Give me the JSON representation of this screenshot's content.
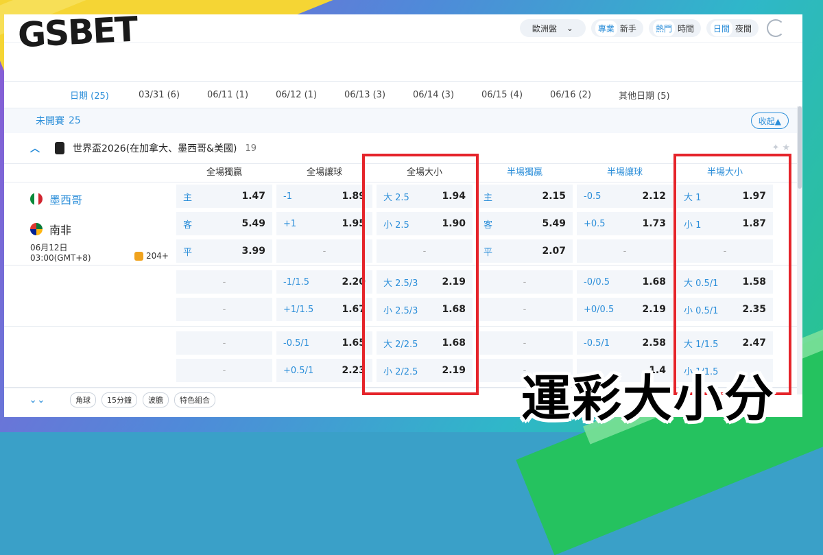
{
  "brand": {
    "logo": "GSBET"
  },
  "headline": "運彩大小分",
  "topbar": {
    "odds_format": "歐洲盤",
    "mode": [
      "專業",
      "新手"
    ],
    "sort": [
      "熱門",
      "時間"
    ],
    "theme": [
      "日間",
      "夜間"
    ]
  },
  "date_tabs": [
    "日期 (25)",
    "03/31 (6)",
    "06/11 (1)",
    "06/12 (1)",
    "06/13 (3)",
    "06/14 (3)",
    "06/15 (4)",
    "06/16 (2)",
    "其他日期 (5)"
  ],
  "section": {
    "title": "未開賽",
    "count": "25",
    "collapse": "收起▲"
  },
  "league": {
    "name": "世界盃2026(在加拿大、墨西哥&美國)",
    "count": "19"
  },
  "columns": [
    "全場獨贏",
    "全場讓球",
    "全場大小",
    "半場獨贏",
    "半場讓球",
    "半場大小"
  ],
  "match": {
    "home": "墨西哥",
    "away": "南非",
    "date": "06月12日",
    "time": "03:00(GMT+8)",
    "more": "204+",
    "rows": [
      [
        {
          "l": "主",
          "v": "1.47"
        },
        {
          "l": "-1",
          "v": "1.89"
        },
        {
          "l": "大 2.5",
          "v": "1.94"
        },
        {
          "l": "主",
          "v": "2.15"
        },
        {
          "l": "-0.5",
          "v": "2.12"
        },
        {
          "l": "大 1",
          "v": "1.97"
        }
      ],
      [
        {
          "l": "客",
          "v": "5.49"
        },
        {
          "l": "+1",
          "v": "1.95"
        },
        {
          "l": "小 2.5",
          "v": "1.90"
        },
        {
          "l": "客",
          "v": "5.49"
        },
        {
          "l": "+0.5",
          "v": "1.73"
        },
        {
          "l": "小 1",
          "v": "1.87"
        }
      ],
      [
        {
          "l": "平",
          "v": "3.99"
        },
        {
          "l": "-",
          "v": ""
        },
        {
          "l": "-",
          "v": ""
        },
        {
          "l": "平",
          "v": "2.07"
        },
        {
          "l": "-",
          "v": ""
        },
        {
          "l": "-",
          "v": ""
        }
      ]
    ]
  },
  "alt_blocks": [
    [
      [
        {
          "l": "-",
          "v": ""
        },
        {
          "l": "-1/1.5",
          "v": "2.20"
        },
        {
          "l": "大 2.5/3",
          "v": "2.19"
        },
        {
          "l": "-",
          "v": ""
        },
        {
          "l": "-0/0.5",
          "v": "1.68"
        },
        {
          "l": "大 0.5/1",
          "v": "1.58"
        }
      ],
      [
        {
          "l": "-",
          "v": ""
        },
        {
          "l": "+1/1.5",
          "v": "1.67"
        },
        {
          "l": "小 2.5/3",
          "v": "1.68"
        },
        {
          "l": "-",
          "v": ""
        },
        {
          "l": "+0/0.5",
          "v": "2.19"
        },
        {
          "l": "小 0.5/1",
          "v": "2.35"
        }
      ]
    ],
    [
      [
        {
          "l": "-",
          "v": ""
        },
        {
          "l": "-0.5/1",
          "v": "1.65"
        },
        {
          "l": "大 2/2.5",
          "v": "1.68"
        },
        {
          "l": "-",
          "v": ""
        },
        {
          "l": "-0.5/1",
          "v": "2.58"
        },
        {
          "l": "大 1/1.5",
          "v": "2.47"
        }
      ],
      [
        {
          "l": "-",
          "v": ""
        },
        {
          "l": "+0.5/1",
          "v": "2.23"
        },
        {
          "l": "小 2/2.5",
          "v": "2.19"
        },
        {
          "l": "-",
          "v": ""
        },
        {
          "l": "",
          "v": "1.4"
        },
        {
          "l": "小 1/1.5",
          "v": ""
        }
      ]
    ]
  ],
  "bottom_chips": [
    "角球",
    "15分鐘",
    "波膽",
    "特色組合"
  ],
  "colors": {
    "accent": "#2b8ed9",
    "highlight": "#e5242a",
    "yellow": "#f5d534",
    "green": "#25c25f"
  }
}
